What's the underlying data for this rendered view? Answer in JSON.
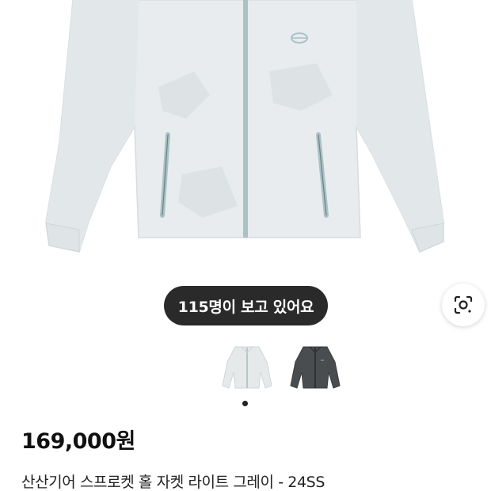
{
  "product_image": {
    "alt": "jacket-image",
    "color": "#e8ecee",
    "accent": "#a9c2c6"
  },
  "viewers_badge": {
    "text": "115명이 보고 있어요"
  },
  "lens_button": {
    "icon": "camera-lens-icon"
  },
  "color_options": [
    {
      "name": "light-gray",
      "swatch": "#e6e9ea"
    },
    {
      "name": "dark-gray",
      "swatch": "#4a4d4f"
    }
  ],
  "carousel": {
    "current": 1,
    "total": 1
  },
  "price": {
    "text": "169,000원"
  },
  "product": {
    "title": "산산기어 스프로켓 홀 자켓 라이트 그레이 - 24SS"
  }
}
